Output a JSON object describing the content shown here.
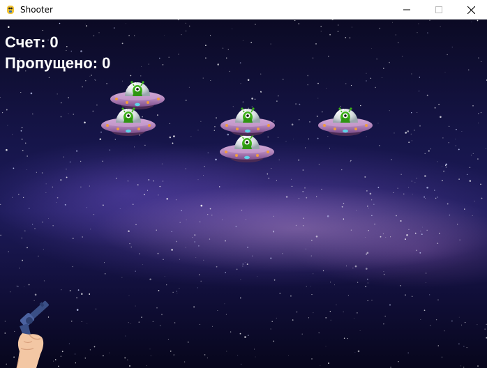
{
  "window": {
    "title": "Shooter",
    "icon": "pygame-snake-icon",
    "controls": [
      "minimize-icon",
      "maximize-icon",
      "close-icon"
    ]
  },
  "hud": {
    "score_label": "Счет:",
    "score_value": "0",
    "missed_label": "Пропущено:",
    "missed_value": "0"
  },
  "game": {
    "background": "starry-galaxy",
    "enemies": [
      {
        "id": "ufo-1",
        "sprite": "ufo-alien"
      },
      {
        "id": "ufo-2",
        "sprite": "ufo-alien"
      },
      {
        "id": "ufo-3",
        "sprite": "ufo-alien"
      },
      {
        "id": "ufo-4",
        "sprite": "ufo-alien"
      },
      {
        "id": "ufo-5",
        "sprite": "ufo-alien"
      }
    ],
    "player": {
      "sprite": "hand-with-revolver"
    }
  },
  "colors": {
    "hud_text": "#ffffff",
    "ufo_body": "#b889c0",
    "ufo_dome": "#dfe6e9",
    "alien": "#3fb21b",
    "gun": "#3a4f86",
    "hand": "#f3c7a4"
  }
}
